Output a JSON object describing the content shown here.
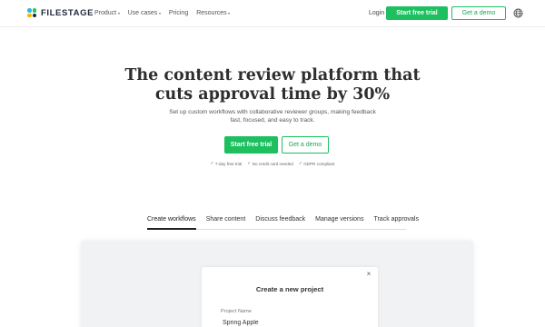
{
  "nav": {
    "logo_text": "FILESTAGE",
    "menu": [
      {
        "label": "Product",
        "has_caret": true
      },
      {
        "label": "Use cases",
        "has_caret": true
      },
      {
        "label": "Pricing",
        "has_caret": false
      },
      {
        "label": "Resources",
        "has_caret": true
      }
    ],
    "login": "Login",
    "start_trial": "Start free trial",
    "get_demo": "Get a demo",
    "globe_icon": "globe-icon"
  },
  "hero": {
    "headline_line1": "The content review platform that",
    "headline_line2": "cuts approval time by 30%",
    "subline": "Set up custom workflows with collaborative reviewer groups, making feedback fast, focused, and easy to track.",
    "start_trial": "Start free trial",
    "get_demo": "Get a demo",
    "checks": [
      "7-day free trial",
      "No credit card needed",
      "GDPR compliant"
    ]
  },
  "tabs": [
    {
      "label": "Create workflows",
      "active": true
    },
    {
      "label": "Share content",
      "active": false
    },
    {
      "label": "Discuss feedback",
      "active": false
    },
    {
      "label": "Manage versions",
      "active": false
    },
    {
      "label": "Track approvals",
      "active": false
    }
  ],
  "preview": {
    "modal_title": "Create a new project",
    "close_glyph": "×",
    "field_label": "Project Name",
    "field_value": "Spring Apple"
  },
  "colors": {
    "accent_green": "#1dbf5f",
    "text_dark": "#2e2e2e",
    "panel_bg": "#f1f2f4"
  }
}
